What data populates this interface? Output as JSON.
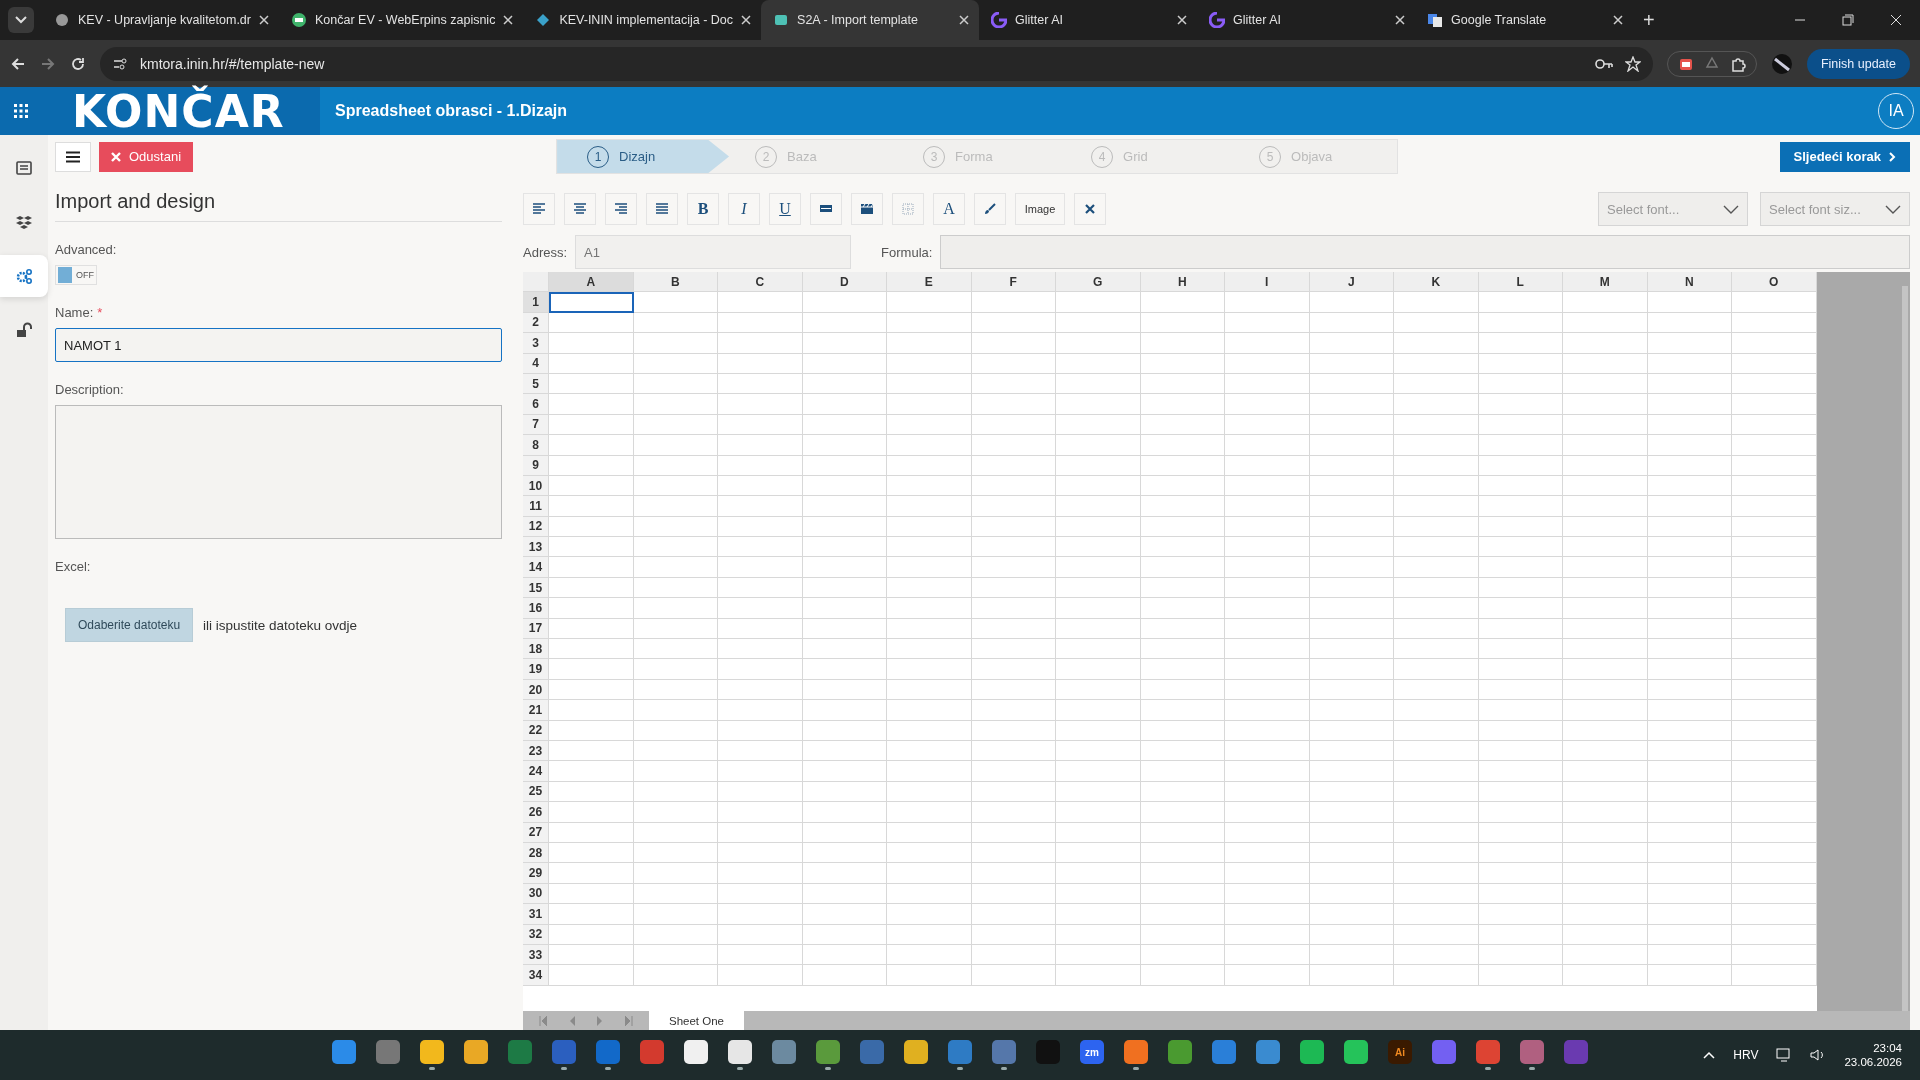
{
  "browser": {
    "tabs": [
      {
        "title": "KEV - Upravljanje kvalitetom.dr",
        "selected": false
      },
      {
        "title": "Končar EV - WebErpins zapisnic",
        "selected": false
      },
      {
        "title": "KEV-ININ implementacija - Doc",
        "selected": false
      },
      {
        "title": "S2A - Import template",
        "selected": true
      },
      {
        "title": "Glitter AI",
        "selected": false
      },
      {
        "title": "Glitter AI",
        "selected": false
      },
      {
        "title": "Google Translate",
        "selected": false
      }
    ],
    "new_tab": "+",
    "url": "kmtora.inin.hr/#/template-new",
    "update_button": "Finish update"
  },
  "header": {
    "logo": "KONČAR",
    "title": "Spreadsheet obrasci - 1.Dizajn",
    "avatar": "IA"
  },
  "rail": [
    {
      "selected": false
    },
    {
      "selected": false
    },
    {
      "selected": true
    },
    {
      "selected": false
    }
  ],
  "actions": {
    "cancel": "Odustani",
    "next": "Sljedeći korak"
  },
  "steps": [
    {
      "number": "1",
      "label": "Dizajn",
      "selected": true
    },
    {
      "number": "2",
      "label": "Baza",
      "selected": false
    },
    {
      "number": "3",
      "label": "Forma",
      "selected": false
    },
    {
      "number": "4",
      "label": "Grid",
      "selected": false
    },
    {
      "number": "5",
      "label": "Objava",
      "selected": false
    }
  ],
  "form": {
    "title": "Import and design",
    "advanced_label": "Advanced:",
    "advanced": {
      "on": false,
      "label": "OFF"
    },
    "name_label": "Name:",
    "required_mark": "*",
    "name_value": "NAMOT 1",
    "description_label": "Description:",
    "excel_label": "Excel:",
    "file_button": "Odaberite datoteku",
    "drop_text": "ili ispustite datoteku ovdje"
  },
  "toolbar": [
    {
      "kind": "icon"
    },
    {
      "kind": "icon"
    },
    {
      "kind": "icon"
    },
    {
      "kind": "icon"
    },
    {
      "kind": "glyph",
      "label": "B"
    },
    {
      "kind": "glyph",
      "label": "I"
    },
    {
      "kind": "glyph",
      "label": "U"
    },
    {
      "kind": "icon"
    },
    {
      "kind": "icon"
    },
    {
      "kind": "icon"
    },
    {
      "kind": "glyph",
      "label": "A"
    },
    {
      "kind": "icon"
    },
    {
      "kind": "text",
      "label": "Image"
    },
    {
      "kind": "icon"
    }
  ],
  "font_select": {
    "placeholder": "Select font..."
  },
  "size_select": {
    "placeholder": "Select font siz..."
  },
  "address": {
    "label": "Adress:",
    "placeholder": "A1"
  },
  "formula": {
    "label": "Formula:"
  },
  "sheet": {
    "columns": [
      {
        "label": "A",
        "selected": true
      },
      {
        "label": "B",
        "selected": false
      },
      {
        "label": "C",
        "selected": false
      },
      {
        "label": "D",
        "selected": false
      },
      {
        "label": "E",
        "selected": false
      },
      {
        "label": "F",
        "selected": false
      },
      {
        "label": "G",
        "selected": false
      },
      {
        "label": "H",
        "selected": false
      },
      {
        "label": "I",
        "selected": false
      },
      {
        "label": "J",
        "selected": false
      },
      {
        "label": "K",
        "selected": false
      },
      {
        "label": "L",
        "selected": false
      },
      {
        "label": "M",
        "selected": false
      },
      {
        "label": "N",
        "selected": false
      },
      {
        "label": "O",
        "selected": false
      }
    ],
    "rows": [
      {
        "label": "1",
        "selected": true
      },
      {
        "label": "2",
        "selected": false
      },
      {
        "label": "3",
        "selected": false
      },
      {
        "label": "4",
        "selected": false
      },
      {
        "label": "5",
        "selected": false
      },
      {
        "label": "6",
        "selected": false
      },
      {
        "label": "7",
        "selected": false
      },
      {
        "label": "8",
        "selected": false
      },
      {
        "label": "9",
        "selected": false
      },
      {
        "label": "10",
        "selected": false
      },
      {
        "label": "11",
        "selected": false
      },
      {
        "label": "12",
        "selected": false
      },
      {
        "label": "13",
        "selected": false
      },
      {
        "label": "14",
        "selected": false
      },
      {
        "label": "15",
        "selected": false
      },
      {
        "label": "16",
        "selected": false
      },
      {
        "label": "17",
        "selected": false
      },
      {
        "label": "18",
        "selected": false
      },
      {
        "label": "19",
        "selected": false
      },
      {
        "label": "20",
        "selected": false
      },
      {
        "label": "21",
        "selected": false
      },
      {
        "label": "22",
        "selected": false
      },
      {
        "label": "23",
        "selected": false
      },
      {
        "label": "24",
        "selected": false
      },
      {
        "label": "25",
        "selected": false
      },
      {
        "label": "26",
        "selected": false
      },
      {
        "label": "27",
        "selected": false
      },
      {
        "label": "28",
        "selected": false
      },
      {
        "label": "29",
        "selected": false
      },
      {
        "label": "30",
        "selected": false
      },
      {
        "label": "31",
        "selected": false
      },
      {
        "label": "32",
        "selected": false
      },
      {
        "label": "33",
        "selected": false
      },
      {
        "label": "34",
        "selected": false
      }
    ],
    "sheet_tabs": [
      {
        "label": "Sheet One",
        "selected": true
      }
    ]
  },
  "taskbar": {
    "apps": [
      {
        "running": false
      },
      {
        "running": false
      },
      {
        "running": true
      },
      {
        "running": false
      },
      {
        "running": false
      },
      {
        "running": true
      },
      {
        "running": true
      },
      {
        "running": false
      },
      {
        "running": false
      },
      {
        "running": true
      },
      {
        "running": false
      },
      {
        "running": true
      },
      {
        "running": false
      },
      {
        "running": false
      },
      {
        "running": true
      },
      {
        "running": true
      },
      {
        "running": false
      },
      {
        "label": "zm",
        "running": false
      },
      {
        "running": true
      },
      {
        "running": false
      },
      {
        "running": false
      },
      {
        "running": false
      },
      {
        "running": false
      },
      {
        "running": false
      },
      {
        "label": "Ai",
        "running": false
      },
      {
        "running": false
      },
      {
        "running": true
      },
      {
        "running": true
      },
      {
        "running": false
      }
    ],
    "language": "HRV",
    "time": "23:04",
    "date": "23.06.2026"
  }
}
